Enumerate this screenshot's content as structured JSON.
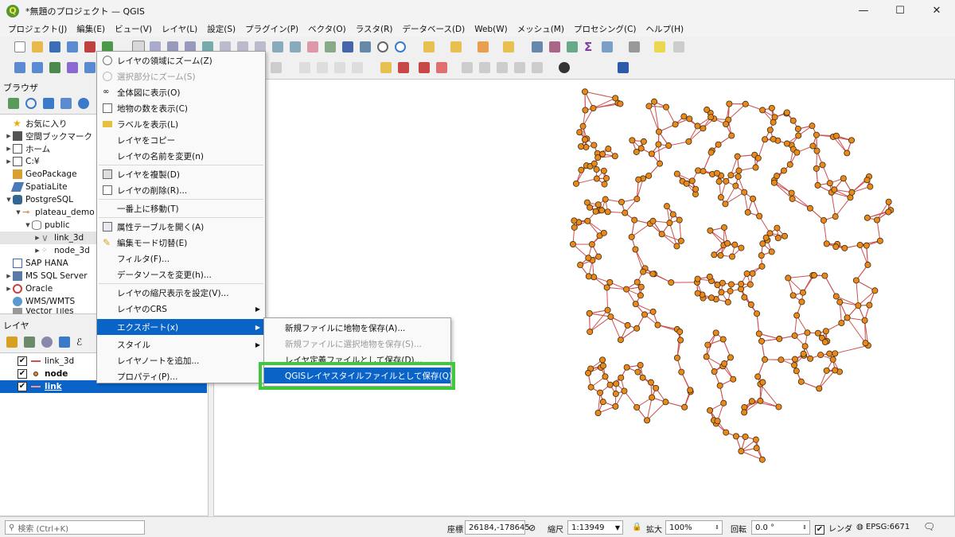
{
  "window": {
    "title": "*無題のプロジェクト — QGIS",
    "logo": "Q"
  },
  "menubar": [
    "プロジェクト(J)",
    "編集(E)",
    "ビュー(V)",
    "レイヤ(L)",
    "設定(S)",
    "プラグイン(P)",
    "ベクタ(O)",
    "ラスタ(R)",
    "データベース(D)",
    "Web(W)",
    "メッシュ(M)",
    "プロセシング(C)",
    "ヘルプ(H)"
  ],
  "browser": {
    "title": "ブラウザ",
    "items": [
      {
        "label": "お気に入り",
        "icon": "star-icon"
      },
      {
        "label": "空間ブックマーク",
        "icon": "bookmark-icon"
      },
      {
        "label": "ホーム",
        "icon": "home-folder-icon"
      },
      {
        "label": "C:¥",
        "icon": "folder-icon"
      },
      {
        "label": "GeoPackage",
        "icon": "geopackage-icon"
      },
      {
        "label": "SpatiaLite",
        "icon": "spatialite-icon"
      },
      {
        "label": "PostgreSQL",
        "icon": "postgresql-icon"
      },
      {
        "label": "plateau_demo",
        "icon": "connection-icon"
      },
      {
        "label": "public",
        "icon": "schema-icon"
      },
      {
        "label": "link_3d",
        "icon": "line-layer-icon"
      },
      {
        "label": "node_3d",
        "icon": "point-layer-icon"
      },
      {
        "label": "SAP HANA",
        "icon": "saphana-icon"
      },
      {
        "label": "MS SQL Server",
        "icon": "mssql-icon"
      },
      {
        "label": "Oracle",
        "icon": "oracle-icon"
      },
      {
        "label": "WMS/WMTS",
        "icon": "wms-icon"
      },
      {
        "label": "Vector Tiles",
        "icon": "vectortiles-icon"
      }
    ]
  },
  "layers": {
    "title": "レイヤ",
    "items": [
      {
        "label": "link_3d",
        "checked": "✔"
      },
      {
        "label": "node",
        "checked": "✔"
      },
      {
        "label": "link",
        "checked": "✔"
      }
    ]
  },
  "context_menu": {
    "items": [
      "レイヤの領域にズーム(Z)",
      "選択部分にズーム(S)",
      "全体図に表示(O)",
      "地物の数を表示(C)",
      "ラベルを表示(L)",
      "レイヤをコピー",
      "レイヤの名前を変更(n)",
      "レイヤを複製(D)",
      "レイヤの削除(R)...",
      "一番上に移動(T)",
      "属性テーブルを開く(A)",
      "編集モード切替(E)",
      "フィルタ(F)...",
      "データソースを変更(h)...",
      "レイヤの縮尺表示を設定(V)...",
      "レイヤのCRS",
      "エクスポート(x)",
      "スタイル",
      "レイヤノートを追加...",
      "プロパティ(P)..."
    ]
  },
  "submenu": {
    "items": [
      "新規ファイルに地物を保存(A)...",
      "新規ファイルに選択地物を保存(S)...",
      "レイヤ定義ファイルとして保存(D)...",
      "QGISレイヤスタイルファイルとして保存(Q)..."
    ]
  },
  "statusbar": {
    "search_placeholder": "検索 (Ctrl+K)",
    "coord_label": "座標",
    "coord_value": "26184,-178645",
    "scale_label": "縮尺",
    "scale_value": "1:13949",
    "magnifier_label": "拡大",
    "magnifier_value": "100%",
    "rotation_label": "回転",
    "rotation_value": "0.0 °",
    "render_label": "レンダ",
    "render_checked": "✔",
    "crs": "EPSG:6671"
  },
  "colors": {
    "accent": "#0a64c8",
    "highlight_box": "#3dc83d",
    "node": "#e8891a",
    "link": "#d05050"
  }
}
